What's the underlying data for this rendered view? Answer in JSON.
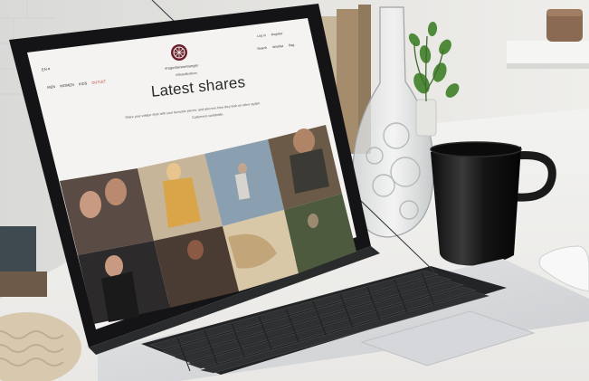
{
  "page": {
    "language": "EN",
    "brand_name": "#rogerbenewmunger",
    "hashtag": "#ShareBrothers",
    "headline": "Latest shares",
    "subtitle_line1": "Share your unique style with your favourite pieces, and also see how they look on other stylish",
    "subtitle_line2": "Customers worldwide.",
    "nav": {
      "men": "MEN",
      "women": "WOMEN",
      "kids": "KIDS",
      "outlet": "OUTLET"
    },
    "top_links": [
      "Log in",
      "Register"
    ],
    "utility_links": [
      "Search",
      "Wishlist",
      "Bag"
    ]
  },
  "colors": {
    "screen_bg": "#f4f3f1",
    "outlet_accent": "#b53a3a",
    "laptop_bezel": "#1c1c1e",
    "mug": "#151515"
  },
  "icons": [
    "instagram-icon",
    "heart-icon",
    "bag-icon",
    "chevron-down-icon"
  ]
}
